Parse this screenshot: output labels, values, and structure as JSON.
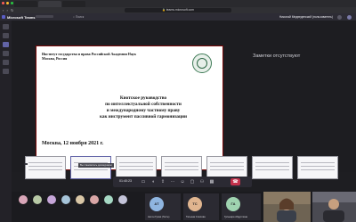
{
  "browser": {
    "tabs": [
      "",
      "",
      ""
    ],
    "url": "teams.microsoft.com",
    "window_dot_colors": [
      "#ff5f57",
      "#febc2e",
      "#28c840"
    ]
  },
  "teams": {
    "app_title": "Microsoft Teams",
    "search_placeholder": "Поиск",
    "user_name": "Николай Медведенский (пользователь)"
  },
  "stage": {
    "share_label": "",
    "slide": {
      "org": "Институт государства и права Российской Академии Наук\nМосква, Россия",
      "title": "Киотское руководство\nпо интеллектуальной собственности\nи международному частному праву\nкак инструмент пассивной гармонизации",
      "date": "Москва, 12 ноября 2021 г."
    },
    "notes_label": "Заметки отсутствуют"
  },
  "thumbnails": {
    "captions": [
      "",
      "Вы становитесь докладчиком"
    ]
  },
  "controls": {
    "timer": "01:40:23",
    "icons": [
      "video-icon",
      "mic-icon",
      "share-icon",
      "more-icon",
      "reactions-icon",
      "chat-icon",
      "people-icon",
      "rooms-icon"
    ]
  },
  "gallery": {
    "avatars": [
      {
        "initials": "",
        "color": "#d9a6b8"
      },
      {
        "initials": "",
        "color": "#b8c9a6"
      },
      {
        "initials": "",
        "color": "#c6a6d9"
      },
      {
        "initials": "",
        "color": "#a6c4d9"
      },
      {
        "initials": "",
        "color": "#d9c6a6"
      },
      {
        "initials": "",
        "color": "#d9a6a6"
      },
      {
        "initials": "",
        "color": "#a6d9c4"
      },
      {
        "initials": "",
        "color": "#c4c4d9"
      }
    ],
    "tiles": [
      {
        "initials": "АТ",
        "name": "Антон Гусев (Гость)",
        "color": "#8fb5e0"
      },
      {
        "initials": "ТС",
        "name": "Татьяна Слепова",
        "color": "#e0b58f"
      },
      {
        "initials": "ГА",
        "name": "Гульнара Абдуллина",
        "color": "#9fd3b0"
      }
    ]
  }
}
